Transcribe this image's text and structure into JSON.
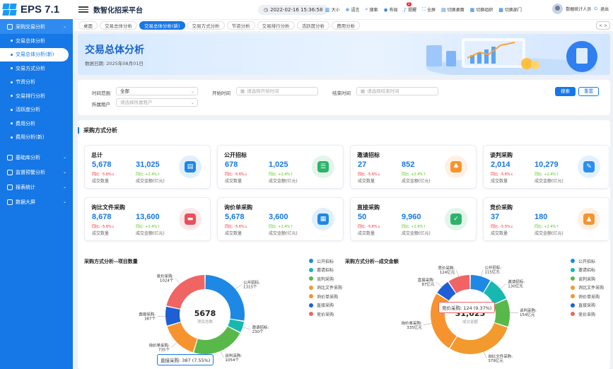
{
  "app": {
    "logo_text": "EPS 7.1",
    "title": "数智化招采平台",
    "datetime": "2022-02-16 15:36:58"
  },
  "toolbar": [
    {
      "icon": "font-size-icon",
      "label": "大小"
    },
    {
      "icon": "language-icon",
      "label": "语言"
    },
    {
      "icon": "search-icon",
      "label": "搜索"
    },
    {
      "icon": "layout-icon",
      "label": "布局"
    },
    {
      "icon": "bell-icon",
      "label": "提醒",
      "badge": "2"
    },
    {
      "icon": "fullscreen-icon",
      "label": "全屏"
    },
    {
      "icon": "switch-desktop-icon",
      "label": "切换桌面"
    },
    {
      "icon": "switch-org-icon",
      "label": "切换组织"
    },
    {
      "icon": "switch-dept-icon",
      "label": "切换部门"
    }
  ],
  "user": {
    "name": "数据统计人员",
    "logout": "退出"
  },
  "sidebar": {
    "groups": [
      {
        "label": "采购交易分析",
        "active": true,
        "items": [
          {
            "label": "交易总体分析",
            "active": false
          },
          {
            "label": "交易总体分析(新)",
            "active": true
          },
          {
            "label": "交易方式分析",
            "active": false
          },
          {
            "label": "节资分析",
            "active": false
          },
          {
            "label": "交易排行分析",
            "active": false
          },
          {
            "label": "活跃度分析",
            "active": false
          },
          {
            "label": "费用分析",
            "active": false
          },
          {
            "label": "费用分析(新)",
            "active": false
          }
        ]
      },
      {
        "label": "基础库分析",
        "active": false,
        "items": []
      },
      {
        "label": "监督预警分析",
        "active": false,
        "items": []
      },
      {
        "label": "报表统计",
        "active": false,
        "items": []
      },
      {
        "label": "数据大屏",
        "active": false,
        "items": []
      }
    ]
  },
  "tabs": [
    {
      "label": "桌面",
      "active": false
    },
    {
      "label": "交易总体分析",
      "active": false
    },
    {
      "label": "交易总体分析(新)",
      "active": true
    },
    {
      "label": "交易方式分析",
      "active": false
    },
    {
      "label": "节资分析",
      "active": false
    },
    {
      "label": "交易排行分析",
      "active": false
    },
    {
      "label": "活跃度分析",
      "active": false
    },
    {
      "label": "费用分析",
      "active": false
    }
  ],
  "tab_controls": "< >",
  "banner": {
    "title": "交易总体分析",
    "date_label": "数据日期: 2025年08月01日"
  },
  "filter": {
    "time_range_label": "时间范围",
    "time_range_value": "全部",
    "start_label": "开始时间",
    "start_placeholder": "请选择开始时间",
    "end_label": "结束时间",
    "end_placeholder": "请选择结束时间",
    "tenant_label": "所属租户",
    "tenant_placeholder": "请选择所属租户",
    "search_btn": "搜索",
    "reset_btn": "重置"
  },
  "section_title": "采购方式分析",
  "cards": [
    {
      "title": "总计",
      "count": "5,678",
      "amount": "31,025",
      "count_change": "同比: -5.6%",
      "amount_change": "同比: +2.4%",
      "count_label": "成交数量",
      "amount_label": "成交金额(亿元)",
      "icon": "chart-board-icon",
      "color": "#1e88e5"
    },
    {
      "title": "公开招标",
      "count": "678",
      "amount": "1,025",
      "count_change": "同比: -5.6%",
      "amount_change": "同比: +2.4%",
      "count_label": "成交数量",
      "amount_label": "成交金额(亿元)",
      "icon": "clipboard-icon",
      "color": "#2fb26b"
    },
    {
      "title": "邀请招标",
      "count": "27",
      "amount": "852",
      "count_change": "同比: -5.6%",
      "amount_change": "同比: +2.4%",
      "count_label": "成交数量",
      "amount_label": "成交金额(亿元)",
      "icon": "users-icon",
      "color": "#f7932e"
    },
    {
      "title": "谈判采购",
      "count": "2,014",
      "amount": "10,279",
      "count_change": "同比: -5.6%",
      "amount_change": "同比: +2.4%",
      "count_label": "成交数量",
      "amount_label": "成交金额(亿元)",
      "icon": "edit-doc-icon",
      "color": "#2b8ff0"
    },
    {
      "title": "询比文件采购",
      "count": "8,678",
      "amount": "13,600",
      "count_change": "同比: -5.6%",
      "amount_change": "同比: +2.4%",
      "count_label": "成交数量",
      "amount_label": "成交金额(亿元)",
      "icon": "document-icon",
      "color": "#e8505b"
    },
    {
      "title": "询价单采购",
      "count": "5,678",
      "amount": "3,600",
      "count_change": "同比: -5.6%",
      "amount_change": "同比: +2.4%",
      "count_label": "成交数量",
      "amount_label": "成交金额(亿元)",
      "icon": "basket-icon",
      "color": "#1e88e5"
    },
    {
      "title": "直接采购",
      "count": "50",
      "amount": "9,960",
      "count_change": "同比: -5.6%",
      "amount_change": "同比: +2.4%",
      "count_label": "成交数量",
      "amount_label": "成交金额(亿元)",
      "icon": "receipt-icon",
      "color": "#2fb26b"
    },
    {
      "title": "竞价采购",
      "count": "37",
      "amount": "180",
      "count_change": "同比: -5.5%",
      "amount_change": "同比: +2.4%",
      "count_label": "成交数量",
      "amount_label": "成交金额(亿元)",
      "icon": "auction-icon",
      "color": "#f7932e"
    }
  ],
  "chart_data": [
    {
      "type": "pie",
      "title": "采购方式分析--项目数量",
      "center_value": "5678",
      "center_label": "项目总数",
      "categories": [
        "公开招标",
        "邀请招标",
        "谈判采购",
        "询比文件采购",
        "询价单采购",
        "直接采购",
        "竞价采购"
      ],
      "values": [
        1315,
        230,
        1054,
        0,
        735,
        387,
        1024
      ],
      "slice_labels": [
        "公开招标: 1315个",
        "邀请招标: 230个",
        "谈判采购: 1054个",
        "",
        "询价单采购: 735个",
        "直接采购: 387个",
        "竞价采购: 1024个"
      ],
      "colors": [
        "#1e88e5",
        "#17b8b0",
        "#59b84a",
        "#f39a2e",
        "#f7932e",
        "#1f5fd6",
        "#f06464"
      ],
      "tooltip": "直接采购: 387 (7.55%)",
      "legend": [
        "公开招标",
        "邀请招标",
        "谈判采购",
        "询比文件采购",
        "询价单采购",
        "直接采购",
        "竞价采购"
      ]
    },
    {
      "type": "pie",
      "title": "采购方式分析--成交金额",
      "center_value": "31,025",
      "center_label": "成交金额",
      "categories": [
        "公开招标",
        "邀请招标",
        "谈判采购",
        "询比文件采购",
        "询价单采购",
        "直接采购",
        "竞价采购"
      ],
      "values": [
        115,
        130,
        154,
        379,
        335,
        87,
        124
      ],
      "slice_labels": [
        "公开招标: 115亿元",
        "邀请招标: 130亿元",
        "谈判采购: 154亿元",
        "询比文件采购: 379亿元",
        "询价单采购: 335亿元",
        "直接采购: 87亿元",
        "竞价采购: 124亿元"
      ],
      "colors": [
        "#1e88e5",
        "#17b8b0",
        "#59b84a",
        "#f39a2e",
        "#f7932e",
        "#1f5fd6",
        "#f06464"
      ],
      "tooltip": "竞价采购: 124 (9.37%)",
      "legend": [
        "公开招标",
        "邀请招标",
        "谈判采购",
        "询比文件采购",
        "询价单采购",
        "直接采购",
        "竞价采购"
      ]
    }
  ]
}
